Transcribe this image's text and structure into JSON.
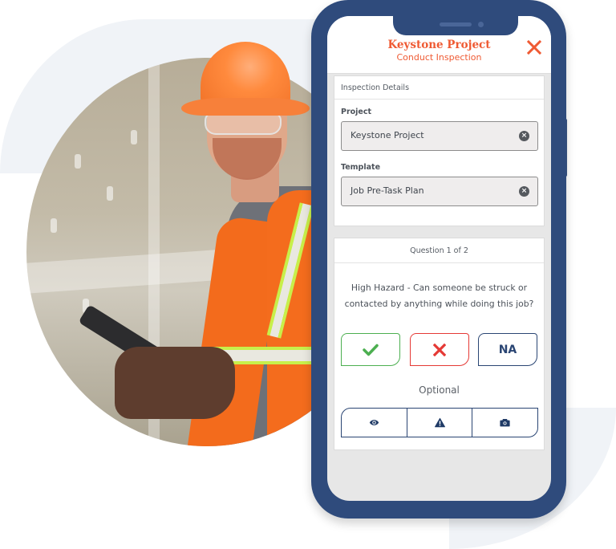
{
  "app": {
    "title": "Keystone Project",
    "subtitle": "Conduct Inspection",
    "close_icon": "close-icon",
    "accent_color": "#ef5a33",
    "frame_color": "#2f4b7c"
  },
  "details_card": {
    "heading": "Inspection Details",
    "fields": [
      {
        "label": "Project",
        "value": "Keystone Project",
        "clear_icon": "clear-circle-icon"
      },
      {
        "label": "Template",
        "value": "Job Pre-Task Plan",
        "clear_icon": "clear-circle-icon"
      }
    ]
  },
  "question_card": {
    "counter": "Question 1 of 2",
    "question": "High Hazard - Can someone be struck or contacted by anything while doing this job?",
    "answers": [
      {
        "name": "yes",
        "label": "✓",
        "icon": "checkmark-icon",
        "color": "#4caf50"
      },
      {
        "name": "no",
        "label": "✕",
        "icon": "x-icon",
        "color": "#e53935"
      },
      {
        "name": "na",
        "label": "NA",
        "color": "#2a4573"
      }
    ],
    "optional_label": "Optional",
    "optional_actions": [
      {
        "name": "observation",
        "icon": "eye-icon"
      },
      {
        "name": "hazard",
        "icon": "warning-icon"
      },
      {
        "name": "photo",
        "icon": "camera-icon"
      }
    ]
  },
  "photo": {
    "subject": "construction worker in orange hard hat and high-visibility vest holding a tablet"
  }
}
